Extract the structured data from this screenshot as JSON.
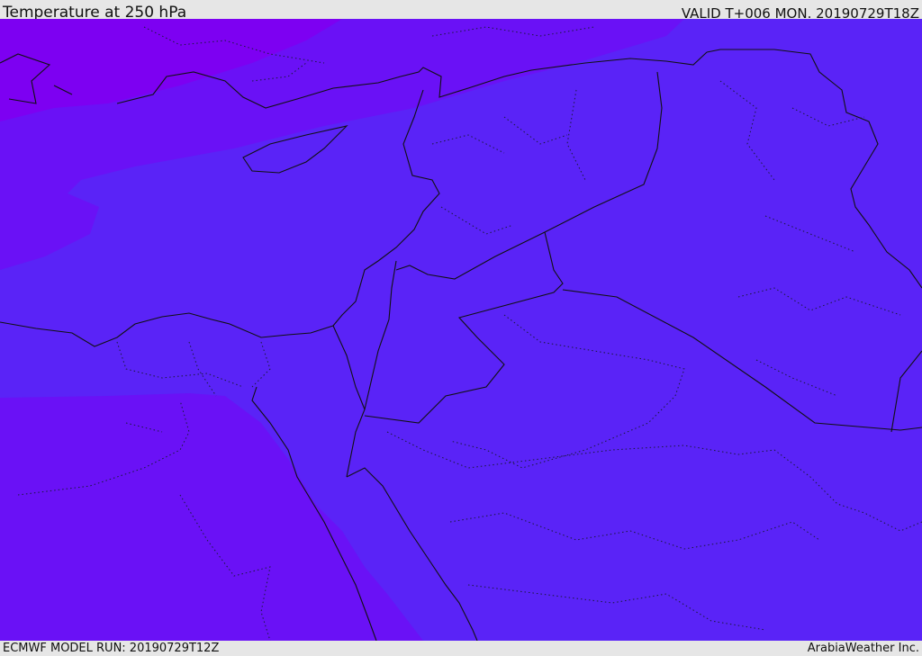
{
  "header": {
    "title": "Temperature at 250 hPa",
    "valid": "VALID T+006 MON. 20190729T18Z"
  },
  "footer": {
    "model_run": "ECMWF MODEL RUN: 20190729T12Z",
    "credit": "ArabiaWeather Inc."
  },
  "colors": {
    "coldest_band": "#7d00f2",
    "cold_band": "#6a11f6",
    "main_band": "#5a23f7",
    "line": "#111111"
  }
}
